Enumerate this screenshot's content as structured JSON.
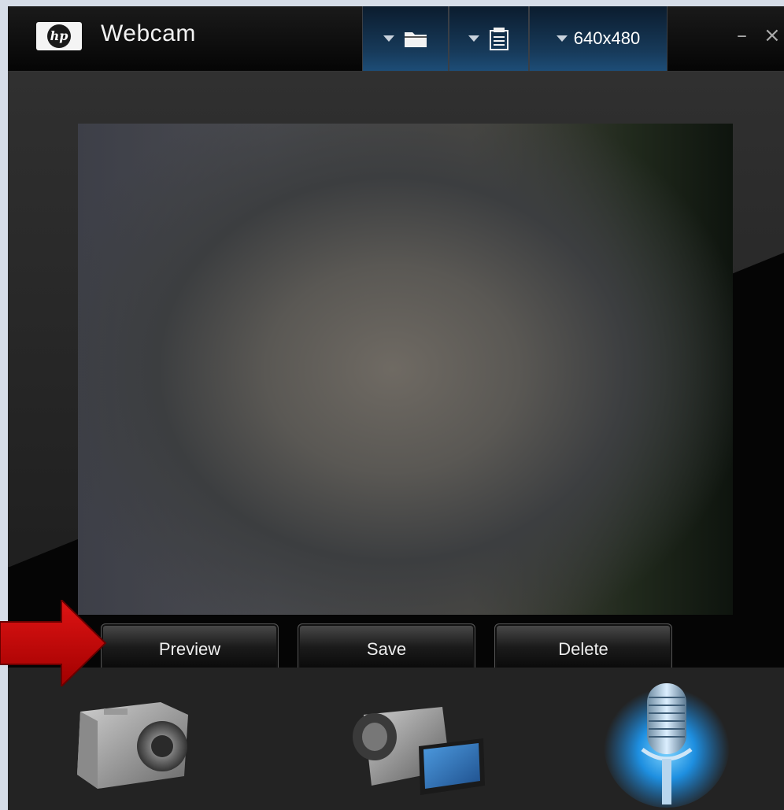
{
  "window": {
    "title": "Webcam",
    "logo_text": "hp"
  },
  "toolbar": {
    "folder_icon": "folder-icon",
    "settings_icon": "document-list-icon",
    "resolution": "640x480",
    "minimize": "–",
    "close": "×"
  },
  "actions": {
    "preview": "Preview",
    "save": "Save",
    "delete": "Delete"
  },
  "modes": [
    {
      "name": "photo",
      "icon": "camera-icon",
      "active": false
    },
    {
      "name": "video",
      "icon": "camcorder-icon",
      "active": false
    },
    {
      "name": "audio",
      "icon": "microphone-icon",
      "active": true
    }
  ],
  "colors": {
    "accent": "#1e7fd0",
    "arrow": "#c40000"
  }
}
